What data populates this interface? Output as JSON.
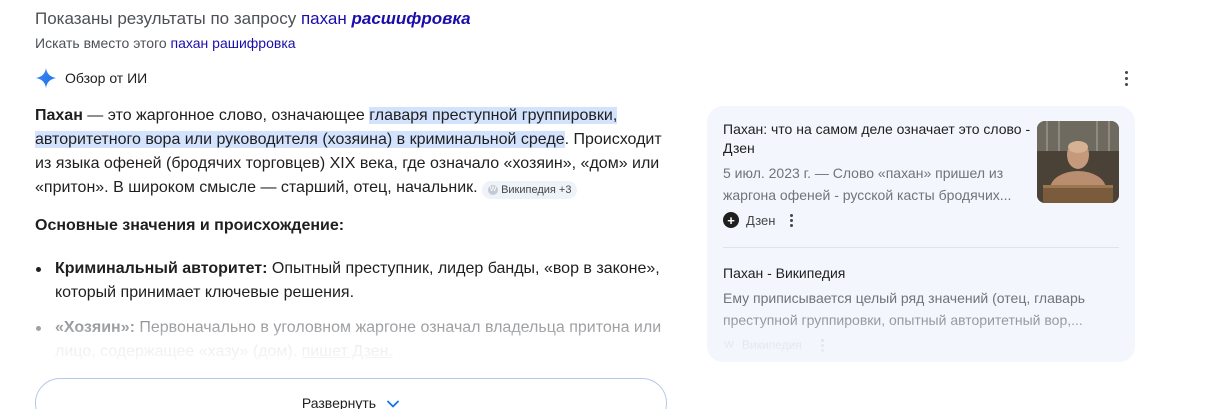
{
  "spelling": {
    "prefix": "Показаны результаты по запросу",
    "query_word": "пахан",
    "query_corrected": "расшифровка",
    "instead_prefix": "Искать вместо этого",
    "instead_link": "пахан рашифровка"
  },
  "ai_overview": {
    "label": "Обзор от ИИ",
    "icon": "sparkle-icon",
    "accent": "#4285f4"
  },
  "answer": {
    "term": "Пахан",
    "intro": " — это жаргонное слово, означающее ",
    "highlight": "главаря преступной группировки, авторитетного вора или руководителя (хозяина) в криминальной среде",
    "rest": ". Происходит из языка офеней (бродячих торговцев) XIX века, где означало «хозяин», «дом» или «притон». В широком смысле — старший, отец, начальник.",
    "chip": "Википедия +3"
  },
  "section_heading": "Основные значения и происхождение:",
  "bullets": [
    {
      "term": "Криминальный авторитет:",
      "text": " Опытный преступник, лидер банды, «вор в законе», который принимает ключевые решения."
    },
    {
      "term": "«Хозяин»:",
      "text": " Первоначально в уголовном жаргоне означал владельца притона или",
      "ghost": "лицо, содержащее «хазу» (дом).",
      "ghost_link": "пишет Дзен."
    }
  ],
  "expand_button": "Развернуть",
  "sources": [
    {
      "title": "Пахан: что на самом деле означает это слово - Дзен",
      "date": "5 июл. 2023 г.",
      "snippet": "Слово «пахан» пришел из жаргона офеней - русской касты бродячих...",
      "site": "Дзен"
    },
    {
      "title": "Пахан - Википедия",
      "snippet": "Ему приписывается целый ряд значений (отец, главарь преступной группировки, опытный авторитетный вор,...",
      "site": "Википедия"
    }
  ]
}
